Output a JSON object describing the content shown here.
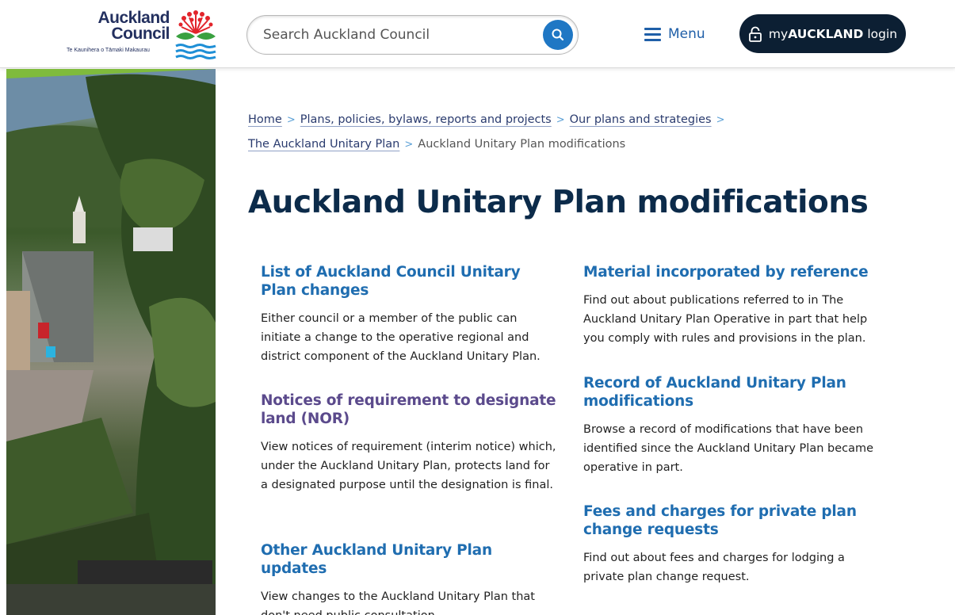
{
  "colors": {
    "brand_navy": "#0c2b4a",
    "link_blue": "#1f6db0",
    "visited_purple": "#5b4a8c",
    "search_button_blue": "#1f77c4",
    "login_bg": "#0c1f33"
  },
  "header": {
    "logo": {
      "line1": "Auckland",
      "line2": "Council",
      "tagline": "Te Kaunihera o Tāmaki Makaurau",
      "icon": "pohutukawa-flower-logo"
    },
    "search": {
      "placeholder": "Search Auckland Council",
      "icon": "search-icon"
    },
    "menu": {
      "label": "Menu",
      "icon": "hamburger-icon"
    },
    "login": {
      "prefix": "my",
      "brand": "AUCKLAND",
      "suffix": "login",
      "icon": "lock-icon"
    }
  },
  "breadcrumb": {
    "items": [
      "Home",
      "Plans, policies, bylaws, reports and projects",
      "Our plans and strategies",
      "The Auckland Unitary Plan"
    ],
    "current": "Auckland Unitary Plan modifications",
    "separator": ">"
  },
  "page_title": "Auckland Unitary Plan modifications",
  "cards": [
    {
      "title": "List of Auckland Council Unitary Plan changes",
      "description": "Either council or a member of the public can initiate a change to the operative regional and district component of the Auckland Unitary Plan."
    },
    {
      "title": "Notices of requirement to designate land (NOR)",
      "description": "View notices of requirement (interim notice) which, under the Auckland Unitary Plan, protects land for a designated purpose until the designation is final."
    },
    {
      "title": "Other Auckland Unitary Plan updates",
      "description": "View changes to the Auckland Unitary Plan that don't need public consultation."
    },
    {
      "title": "Material incorporated by reference",
      "description": "Find out about publications referred to in The Auckland Unitary Plan Operative in part that help you comply with rules and provisions in the plan."
    },
    {
      "title": "Record of Auckland Unitary Plan modifications",
      "description": "Browse a record of modifications that have been identified since the Auckland Unitary Plan became operative in part."
    },
    {
      "title": "Fees and charges for private plan change requests",
      "description": "Find out about fees and charges for lodging a private plan change request."
    }
  ]
}
